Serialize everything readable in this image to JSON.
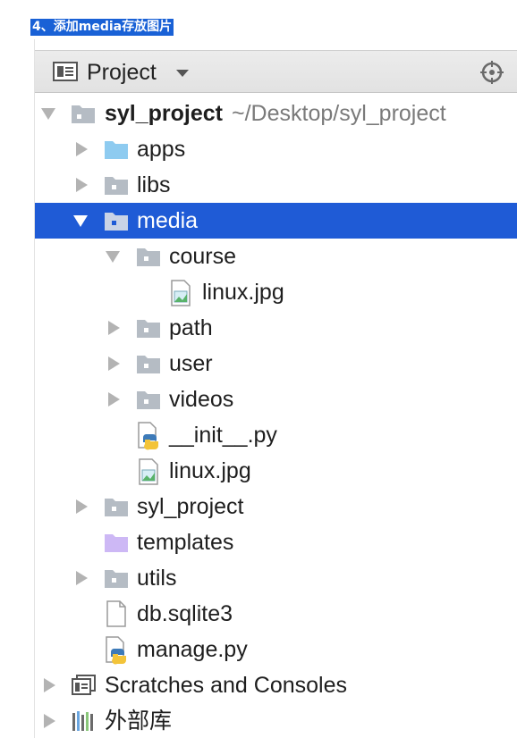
{
  "caption": "4、添加media存放图片",
  "toolbar": {
    "title": "Project",
    "icons": {
      "project": "project-view-icon",
      "dropdown": "dropdown-icon",
      "locate": "locate-icon"
    }
  },
  "tree": {
    "root": {
      "name": "syl_project",
      "path": "~/Desktop/syl_project"
    },
    "apps": "apps",
    "libs": "libs",
    "media": "media",
    "course": "course",
    "course_image": "linux.jpg",
    "path": "path",
    "user": "user",
    "videos": "videos",
    "init_py": "__init__.py",
    "media_image": "linux.jpg",
    "syl_project": "syl_project",
    "templates": "templates",
    "utils": "utils",
    "db": "db.sqlite3",
    "manage": "manage.py",
    "scratches": "Scratches and Consoles",
    "external_libs": "外部库"
  },
  "colors": {
    "selection": "#1f5bd6",
    "caption_bg": "#1961d6",
    "folder": "#b5bcc4",
    "source_folder": "#8ecbf0",
    "template_folder": "#cdb8f5"
  }
}
